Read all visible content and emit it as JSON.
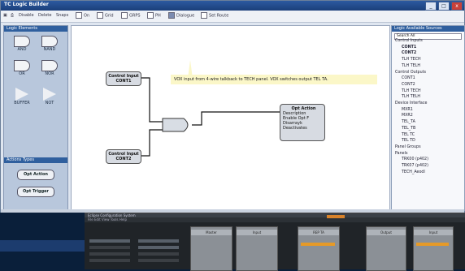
{
  "window": {
    "title": "TC Logic Builder",
    "buttons": [
      "_",
      "□",
      "x"
    ]
  },
  "toolbar": {
    "items": [
      "Disable",
      "Delete",
      "Snaps",
      "On",
      "Grid",
      "GRPS",
      "PH",
      "Dialogue",
      "Set Route"
    ]
  },
  "left_panel": {
    "title": "Logic Elements",
    "gates": [
      "AND",
      "NAND",
      "OR",
      "NOR",
      "BUFFER",
      "NOT"
    ],
    "section_title": "Actions Types",
    "buttons": [
      "Opt Action",
      "Opt Trigger"
    ]
  },
  "canvas": {
    "node_input1": [
      "Control Input",
      "CONT1"
    ],
    "node_input2": [
      "Control Input",
      "CONT2"
    ],
    "node_output": {
      "title": "Opt Action",
      "lines": [
        "Description",
        "Enable Opt F",
        "Disarrayk",
        "Deactivates"
      ]
    },
    "tooltip": "VOX input from 4-wire talkback to TECH panel. VOX switches output TEL TA."
  },
  "right_panel": {
    "title": "Logic Available Sources",
    "search": "Search All",
    "tree": [
      {
        "label": "Control Inputs",
        "level": 0,
        "bold": false
      },
      {
        "label": "CONT1",
        "level": 1,
        "bold": true
      },
      {
        "label": "CONT2",
        "level": 1,
        "bold": true
      },
      {
        "label": "TLH TECH",
        "level": 1,
        "bold": false
      },
      {
        "label": "TLH TELH",
        "level": 1,
        "bold": false
      },
      {
        "label": "Control Outputs",
        "level": 0,
        "bold": false
      },
      {
        "label": "CONT1",
        "level": 1,
        "bold": false
      },
      {
        "label": "CONT2",
        "level": 1,
        "bold": false
      },
      {
        "label": "TLH TECH",
        "level": 1,
        "bold": false
      },
      {
        "label": "TLH TELH",
        "level": 1,
        "bold": false
      },
      {
        "label": "Device Interface",
        "level": 0,
        "bold": false
      },
      {
        "label": "MXR1",
        "level": 1,
        "bold": false
      },
      {
        "label": "MXR2",
        "level": 1,
        "bold": false
      },
      {
        "label": "TEL_TA",
        "level": 1,
        "bold": false
      },
      {
        "label": "TEL_TB",
        "level": 1,
        "bold": false
      },
      {
        "label": "TEL TC",
        "level": 1,
        "bold": false
      },
      {
        "label": "TEL TD",
        "level": 1,
        "bold": false
      },
      {
        "label": "Panel Groups",
        "level": 0,
        "bold": false
      },
      {
        "label": "Panels",
        "level": 0,
        "bold": false
      },
      {
        "label": "TRK00 (p402)",
        "level": 1,
        "bold": false
      },
      {
        "label": "TRK07 (p402)",
        "level": 1,
        "bold": false
      },
      {
        "label": "TECH_Aeodl",
        "level": 1,
        "bold": false
      }
    ]
  },
  "mixer": {
    "title": "Eclipse Configuration System",
    "toolbar": "File  Edit  View  Tools  Help",
    "strips": [
      "Master",
      "Input",
      "REP  TA",
      "",
      "Output",
      "Input"
    ]
  }
}
